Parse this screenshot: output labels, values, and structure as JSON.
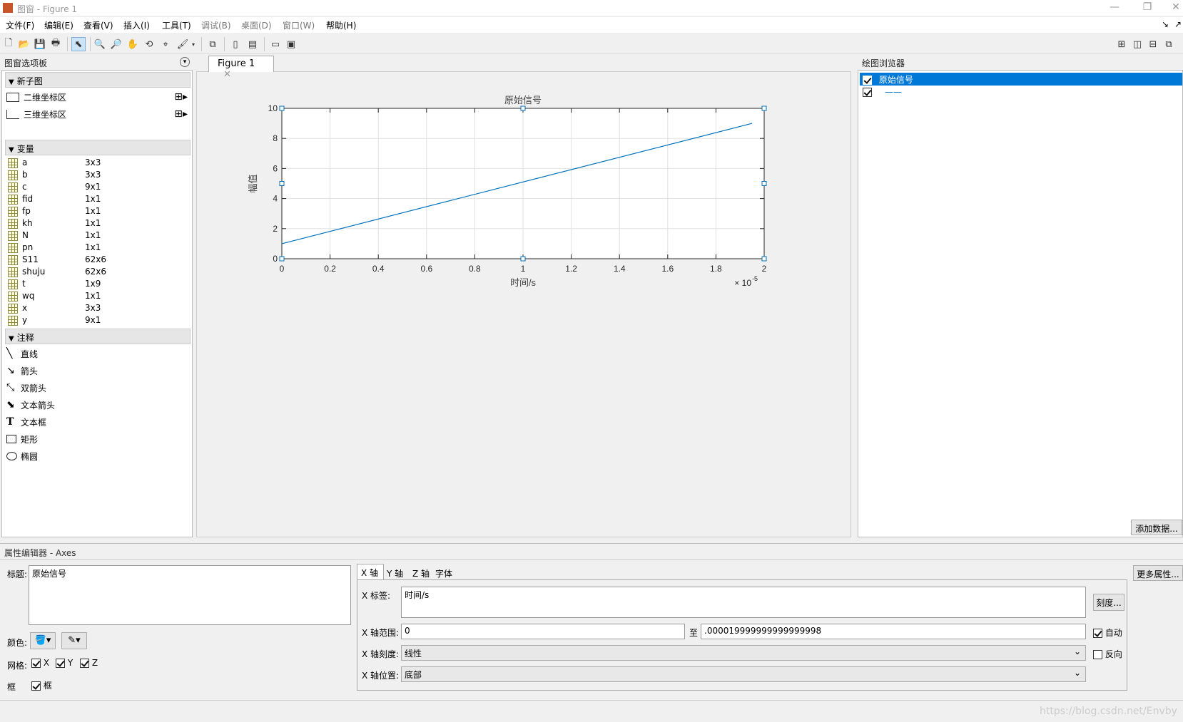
{
  "window": {
    "title": "图窗 - Figure 1"
  },
  "menu": [
    "文件(F)",
    "编辑(E)",
    "查看(V)",
    "插入(I)",
    "工具(T)",
    "调试(B)",
    "桌面(D)",
    "窗口(W)",
    "帮助(H)"
  ],
  "palette": {
    "title": "图窗选项板",
    "sections": {
      "subplots": "新子图",
      "variables": "变量",
      "annotations": "注释"
    },
    "subplots": [
      "二维坐标区",
      "三维坐标区"
    ],
    "variables": [
      {
        "name": "a",
        "size": "3x3"
      },
      {
        "name": "b",
        "size": "3x3"
      },
      {
        "name": "c",
        "size": "9x1"
      },
      {
        "name": "fid",
        "size": "1x1"
      },
      {
        "name": "fp",
        "size": "1x1"
      },
      {
        "name": "kh",
        "size": "1x1"
      },
      {
        "name": "N",
        "size": "1x1"
      },
      {
        "name": "pn",
        "size": "1x1"
      },
      {
        "name": "S11",
        "size": "62x6"
      },
      {
        "name": "shuju",
        "size": "62x6"
      },
      {
        "name": "t",
        "size": "1x9"
      },
      {
        "name": "wq",
        "size": "1x1"
      },
      {
        "name": "x",
        "size": "3x3"
      },
      {
        "name": "y",
        "size": "9x1"
      }
    ],
    "annotations": [
      "直线",
      "箭头",
      "双箭头",
      "文本箭头",
      "文本框",
      "矩形",
      "椭圆"
    ]
  },
  "figure_tab": "Figure 1",
  "chart_data": {
    "type": "line",
    "title": "原始信号",
    "xlabel": "时间/s",
    "ylabel": "幅值",
    "x_exponent": "× 10",
    "x_exponent_power": "-5",
    "xlim": [
      0,
      2
    ],
    "ylim": [
      0,
      10
    ],
    "xticks": [
      "0",
      "0.2",
      "0.4",
      "0.6",
      "0.8",
      "1",
      "1.2",
      "1.4",
      "1.6",
      "1.8",
      "2"
    ],
    "yticks": [
      "0",
      "2",
      "4",
      "6",
      "8",
      "10"
    ],
    "grid": true,
    "series": [
      {
        "x": [
          0,
          1.95
        ],
        "y": [
          1,
          9
        ],
        "color": "#0072bd"
      }
    ]
  },
  "browser": {
    "title": "绘图浏览器",
    "items": [
      "原始信号",
      "——"
    ],
    "add_button": "添加数据..."
  },
  "prop_editor": {
    "title": "属性编辑器 - Axes",
    "title_label": "标题:",
    "title_value": "原始信号",
    "color_label": "颜色:",
    "grid_label": "网格:",
    "grid_items": [
      "X",
      "Y",
      "Z"
    ],
    "box_label": "框",
    "box_check": "框",
    "tabs": [
      "X 轴",
      "Y 轴",
      "Z 轴",
      "字体"
    ],
    "xlabel_label": "X 标签:",
    "xlabel_value": "时间/s",
    "ticks_button": "刻度...",
    "xrange_label": "X 轴范围:",
    "xrange_min": "0",
    "to_label": "至",
    "xrange_max": ".000019999999999999998",
    "auto_label": "自动",
    "xscale_label": "X 轴刻度:",
    "xscale_value": "线性",
    "reverse_label": "反向",
    "xloc_label": "X 轴位置:",
    "xloc_value": "底部",
    "more_button": "更多属性..."
  },
  "watermark": "https://blog.csdn.net/Envby"
}
